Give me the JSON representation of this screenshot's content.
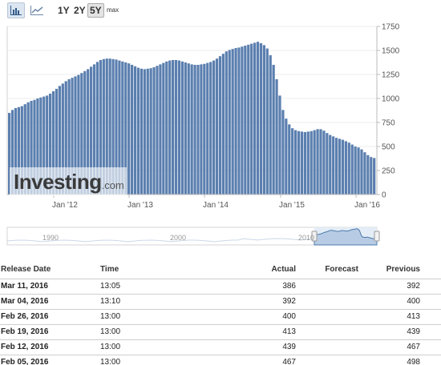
{
  "toolbar": {
    "chart_type_icons": [
      "bar-chart-icon",
      "line-chart-icon"
    ],
    "ranges": [
      "1Y",
      "2Y",
      "5Y",
      "max"
    ],
    "active_range": "5Y"
  },
  "watermark": {
    "brand": "Investing",
    "suffix": ".com"
  },
  "chart_data": {
    "type": "bar",
    "x_labels": [
      "Jan '12",
      "Jan '13",
      "Jan '14",
      "Jan '15",
      "Jan '16"
    ],
    "y_ticks": [
      0,
      250,
      500,
      750,
      1000,
      1250,
      1500,
      1750
    ],
    "ylim": [
      0,
      1750
    ],
    "bar_color": "#5b7faf",
    "values": [
      850,
      880,
      900,
      910,
      920,
      940,
      960,
      975,
      985,
      1000,
      1010,
      1020,
      1030,
      1050,
      1075,
      1100,
      1130,
      1155,
      1180,
      1200,
      1215,
      1230,
      1245,
      1265,
      1285,
      1305,
      1330,
      1355,
      1380,
      1400,
      1410,
      1415,
      1415,
      1410,
      1405,
      1395,
      1385,
      1375,
      1365,
      1350,
      1335,
      1320,
      1310,
      1305,
      1310,
      1315,
      1325,
      1340,
      1355,
      1370,
      1385,
      1395,
      1400,
      1400,
      1395,
      1385,
      1375,
      1365,
      1355,
      1350,
      1350,
      1355,
      1360,
      1370,
      1380,
      1395,
      1415,
      1440,
      1465,
      1490,
      1505,
      1515,
      1525,
      1530,
      1540,
      1550,
      1560,
      1570,
      1580,
      1590,
      1575,
      1555,
      1520,
      1450,
      1350,
      1200,
      1030,
      880,
      790,
      730,
      690,
      670,
      660,
      655,
      650,
      655,
      660,
      670,
      680,
      680,
      665,
      640,
      620,
      605,
      590,
      580,
      570,
      555,
      540,
      520,
      500,
      490,
      470,
      440,
      410,
      390,
      380
    ]
  },
  "navigator": {
    "labels": [
      "1990",
      "2000",
      "2010"
    ]
  },
  "table": {
    "headers": [
      "Release Date",
      "Time",
      "Actual",
      "Forecast",
      "Previous"
    ],
    "rows": [
      {
        "date": "Mar 11, 2016",
        "time": "13:05",
        "actual": "386",
        "forecast": "",
        "previous": "392"
      },
      {
        "date": "Mar 04, 2016",
        "time": "13:10",
        "actual": "392",
        "forecast": "",
        "previous": "400"
      },
      {
        "date": "Feb 26, 2016",
        "time": "13:00",
        "actual": "400",
        "forecast": "",
        "previous": "413"
      },
      {
        "date": "Feb 19, 2016",
        "time": "13:00",
        "actual": "413",
        "forecast": "",
        "previous": "439"
      },
      {
        "date": "Feb 12, 2016",
        "time": "13:00",
        "actual": "439",
        "forecast": "",
        "previous": "467"
      },
      {
        "date": "Feb 05, 2016",
        "time": "13:00",
        "actual": "467",
        "forecast": "",
        "previous": "498"
      }
    ]
  }
}
